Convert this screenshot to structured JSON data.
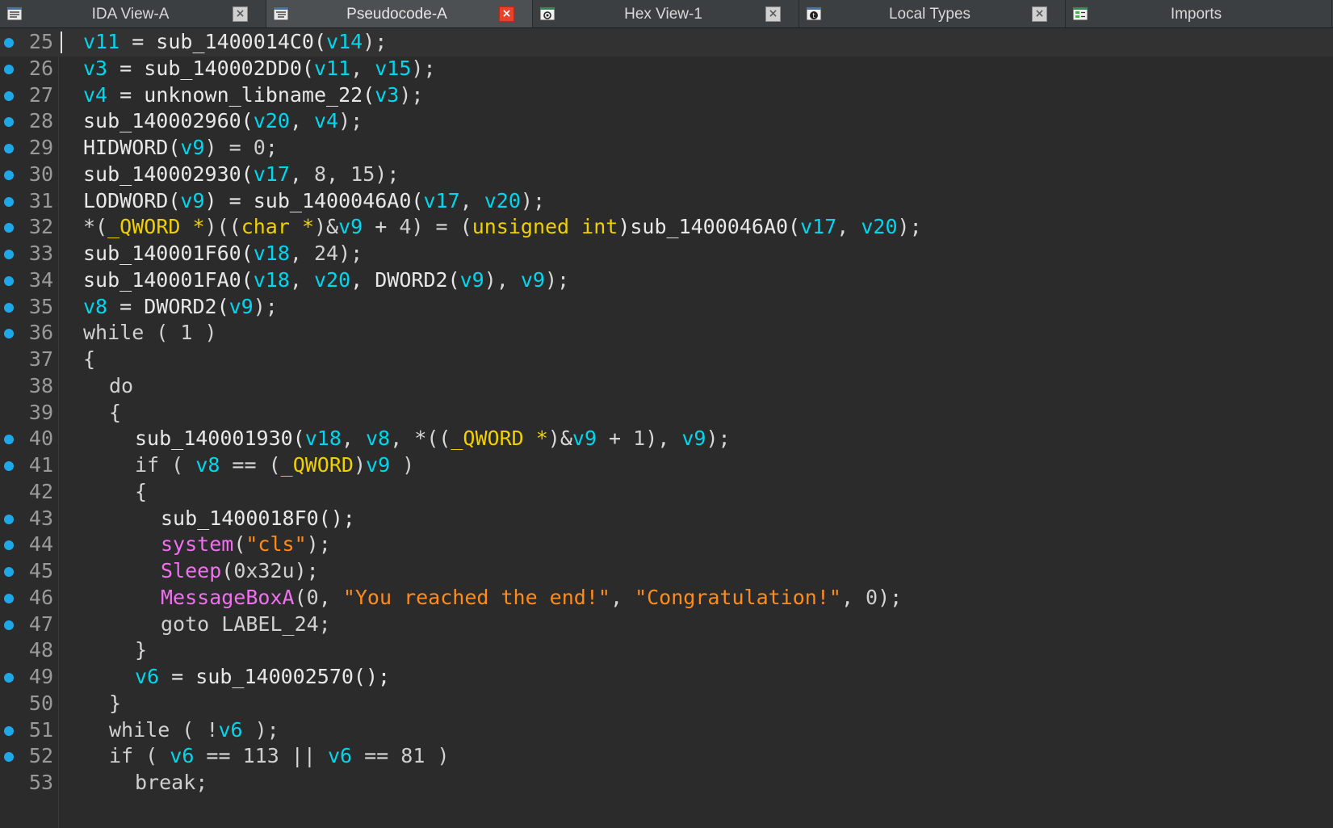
{
  "tabs": [
    {
      "label": "IDA View-A",
      "icon": "disassembly-icon",
      "active": false
    },
    {
      "label": "Pseudocode-A",
      "icon": "pseudocode-icon",
      "active": true
    },
    {
      "label": "Hex View-1",
      "icon": "hex-view-icon",
      "active": false
    },
    {
      "label": "Local Types",
      "icon": "local-types-icon",
      "active": false
    },
    {
      "label": "Imports",
      "icon": "imports-icon",
      "active": false
    }
  ],
  "colors": {
    "variable": "#00d7ee",
    "type": "#f0d000",
    "string": "#ff8c1a",
    "import": "#f070f0",
    "breakpoint_dot": "#1ea8e8",
    "active_tab_close": "#e8412c"
  },
  "lines": [
    {
      "n": "25",
      "dot": true,
      "indent": 0,
      "tokens": [
        [
          "v11",
          "var"
        ],
        [
          " = sub_1400014C0(",
          "fn"
        ],
        [
          "v14",
          "var"
        ],
        [
          ");",
          "punc"
        ]
      ]
    },
    {
      "n": "26",
      "dot": true,
      "indent": 0,
      "tokens": [
        [
          "v3",
          "var"
        ],
        [
          " = sub_140002DD0(",
          "fn"
        ],
        [
          "v11",
          "var"
        ],
        [
          ", ",
          "punc"
        ],
        [
          "v15",
          "var"
        ],
        [
          ");",
          "punc"
        ]
      ]
    },
    {
      "n": "27",
      "dot": true,
      "indent": 0,
      "tokens": [
        [
          "v4",
          "var"
        ],
        [
          " = unknown_libname_22(",
          "fn"
        ],
        [
          "v3",
          "var"
        ],
        [
          ");",
          "punc"
        ]
      ]
    },
    {
      "n": "28",
      "dot": true,
      "indent": 0,
      "tokens": [
        [
          "sub_140002960(",
          "fn"
        ],
        [
          "v20",
          "var"
        ],
        [
          ", ",
          "punc"
        ],
        [
          "v4",
          "var"
        ],
        [
          ");",
          "punc"
        ]
      ]
    },
    {
      "n": "29",
      "dot": true,
      "indent": 0,
      "tokens": [
        [
          "HIDWORD(",
          "fn"
        ],
        [
          "v9",
          "var"
        ],
        [
          ") = ",
          "punc"
        ],
        [
          "0",
          "num"
        ],
        [
          ";",
          "punc"
        ]
      ]
    },
    {
      "n": "30",
      "dot": true,
      "indent": 0,
      "tokens": [
        [
          "sub_140002930(",
          "fn"
        ],
        [
          "v17",
          "var"
        ],
        [
          ", ",
          "punc"
        ],
        [
          "8",
          "num"
        ],
        [
          ", ",
          "punc"
        ],
        [
          "15",
          "num"
        ],
        [
          ");",
          "punc"
        ]
      ]
    },
    {
      "n": "31",
      "dot": true,
      "indent": 0,
      "tokens": [
        [
          "LODWORD(",
          "fn"
        ],
        [
          "v9",
          "var"
        ],
        [
          ") = sub_1400046A0(",
          "fn"
        ],
        [
          "v17",
          "var"
        ],
        [
          ", ",
          "punc"
        ],
        [
          "v20",
          "var"
        ],
        [
          ");",
          "punc"
        ]
      ]
    },
    {
      "n": "32",
      "dot": true,
      "indent": 0,
      "tokens": [
        [
          "*(",
          "punc"
        ],
        [
          "_QWORD *",
          "type"
        ],
        [
          ")((",
          "punc"
        ],
        [
          "char *",
          "type"
        ],
        [
          ")&",
          "punc"
        ],
        [
          "v9",
          "var"
        ],
        [
          " + ",
          "punc"
        ],
        [
          "4",
          "num"
        ],
        [
          ") = (",
          "punc"
        ],
        [
          "unsigned int",
          "type"
        ],
        [
          ")sub_1400046A0(",
          "fn"
        ],
        [
          "v17",
          "var"
        ],
        [
          ", ",
          "punc"
        ],
        [
          "v20",
          "var"
        ],
        [
          ");",
          "punc"
        ]
      ]
    },
    {
      "n": "33",
      "dot": true,
      "indent": 0,
      "tokens": [
        [
          "sub_140001F60(",
          "fn"
        ],
        [
          "v18",
          "var"
        ],
        [
          ", ",
          "punc"
        ],
        [
          "24",
          "num"
        ],
        [
          ");",
          "punc"
        ]
      ]
    },
    {
      "n": "34",
      "dot": true,
      "indent": 0,
      "tokens": [
        [
          "sub_140001FA0(",
          "fn"
        ],
        [
          "v18",
          "var"
        ],
        [
          ", ",
          "punc"
        ],
        [
          "v20",
          "var"
        ],
        [
          ", DWORD2(",
          "fn"
        ],
        [
          "v9",
          "var"
        ],
        [
          "), ",
          "punc"
        ],
        [
          "v9",
          "var"
        ],
        [
          ");",
          "punc"
        ]
      ]
    },
    {
      "n": "35",
      "dot": true,
      "indent": 0,
      "tokens": [
        [
          "v8",
          "var"
        ],
        [
          " = DWORD2(",
          "fn"
        ],
        [
          "v9",
          "var"
        ],
        [
          ");",
          "punc"
        ]
      ]
    },
    {
      "n": "36",
      "dot": true,
      "indent": 0,
      "tokens": [
        [
          "while ( ",
          "kw"
        ],
        [
          "1",
          "num"
        ],
        [
          " )",
          "kw"
        ]
      ]
    },
    {
      "n": "37",
      "dot": false,
      "indent": 0,
      "tokens": [
        [
          "{",
          "punc"
        ]
      ]
    },
    {
      "n": "38",
      "dot": false,
      "indent": 1,
      "tokens": [
        [
          "do",
          "kw"
        ]
      ]
    },
    {
      "n": "39",
      "dot": false,
      "indent": 1,
      "tokens": [
        [
          "{",
          "punc"
        ]
      ]
    },
    {
      "n": "40",
      "dot": true,
      "indent": 2,
      "tokens": [
        [
          "sub_140001930(",
          "fn"
        ],
        [
          "v18",
          "var"
        ],
        [
          ", ",
          "punc"
        ],
        [
          "v8",
          "var"
        ],
        [
          ", *((",
          "punc"
        ],
        [
          "_QWORD *",
          "type"
        ],
        [
          ")&",
          "punc"
        ],
        [
          "v9",
          "var"
        ],
        [
          " + ",
          "punc"
        ],
        [
          "1",
          "num"
        ],
        [
          "), ",
          "punc"
        ],
        [
          "v9",
          "var"
        ],
        [
          ");",
          "punc"
        ]
      ]
    },
    {
      "n": "41",
      "dot": true,
      "indent": 2,
      "tokens": [
        [
          "if ( ",
          "kw"
        ],
        [
          "v8",
          "var"
        ],
        [
          " == (",
          "punc"
        ],
        [
          "_QWORD",
          "type"
        ],
        [
          ")",
          "punc"
        ],
        [
          "v9",
          "var"
        ],
        [
          " )",
          "kw"
        ]
      ]
    },
    {
      "n": "42",
      "dot": false,
      "indent": 2,
      "tokens": [
        [
          "{",
          "punc"
        ]
      ]
    },
    {
      "n": "43",
      "dot": true,
      "indent": 3,
      "tokens": [
        [
          "sub_1400018F0();",
          "fn"
        ]
      ]
    },
    {
      "n": "44",
      "dot": true,
      "indent": 3,
      "tokens": [
        [
          "system",
          "imp"
        ],
        [
          "(",
          "punc"
        ],
        [
          "\"cls\"",
          "str"
        ],
        [
          ");",
          "punc"
        ]
      ]
    },
    {
      "n": "45",
      "dot": true,
      "indent": 3,
      "tokens": [
        [
          "Sleep",
          "imp"
        ],
        [
          "(",
          "punc"
        ],
        [
          "0x32u",
          "num"
        ],
        [
          ");",
          "punc"
        ]
      ]
    },
    {
      "n": "46",
      "dot": true,
      "indent": 3,
      "tokens": [
        [
          "MessageBoxA",
          "imp"
        ],
        [
          "(",
          "punc"
        ],
        [
          "0",
          "num"
        ],
        [
          ", ",
          "punc"
        ],
        [
          "\"You reached the end!\"",
          "str"
        ],
        [
          ", ",
          "punc"
        ],
        [
          "\"Congratulation!\"",
          "str"
        ],
        [
          ", ",
          "punc"
        ],
        [
          "0",
          "num"
        ],
        [
          ");",
          "punc"
        ]
      ]
    },
    {
      "n": "47",
      "dot": true,
      "indent": 3,
      "tokens": [
        [
          "goto LABEL_24;",
          "kw"
        ]
      ]
    },
    {
      "n": "48",
      "dot": false,
      "indent": 2,
      "tokens": [
        [
          "}",
          "punc"
        ]
      ]
    },
    {
      "n": "49",
      "dot": true,
      "indent": 2,
      "tokens": [
        [
          "v6",
          "var"
        ],
        [
          " = sub_140002570();",
          "fn"
        ]
      ]
    },
    {
      "n": "50",
      "dot": false,
      "indent": 1,
      "tokens": [
        [
          "}",
          "punc"
        ]
      ]
    },
    {
      "n": "51",
      "dot": true,
      "indent": 1,
      "tokens": [
        [
          "while ( !",
          "kw"
        ],
        [
          "v6",
          "var"
        ],
        [
          " );",
          "kw"
        ]
      ]
    },
    {
      "n": "52",
      "dot": true,
      "indent": 1,
      "tokens": [
        [
          "if ( ",
          "kw"
        ],
        [
          "v6",
          "var"
        ],
        [
          " == ",
          "punc"
        ],
        [
          "113",
          "num"
        ],
        [
          " || ",
          "punc"
        ],
        [
          "v6",
          "var"
        ],
        [
          " == ",
          "punc"
        ],
        [
          "81",
          "num"
        ],
        [
          " )",
          "kw"
        ]
      ]
    },
    {
      "n": "53",
      "dot": false,
      "indent": 2,
      "tokens": [
        [
          "break;",
          "kw"
        ]
      ]
    }
  ]
}
